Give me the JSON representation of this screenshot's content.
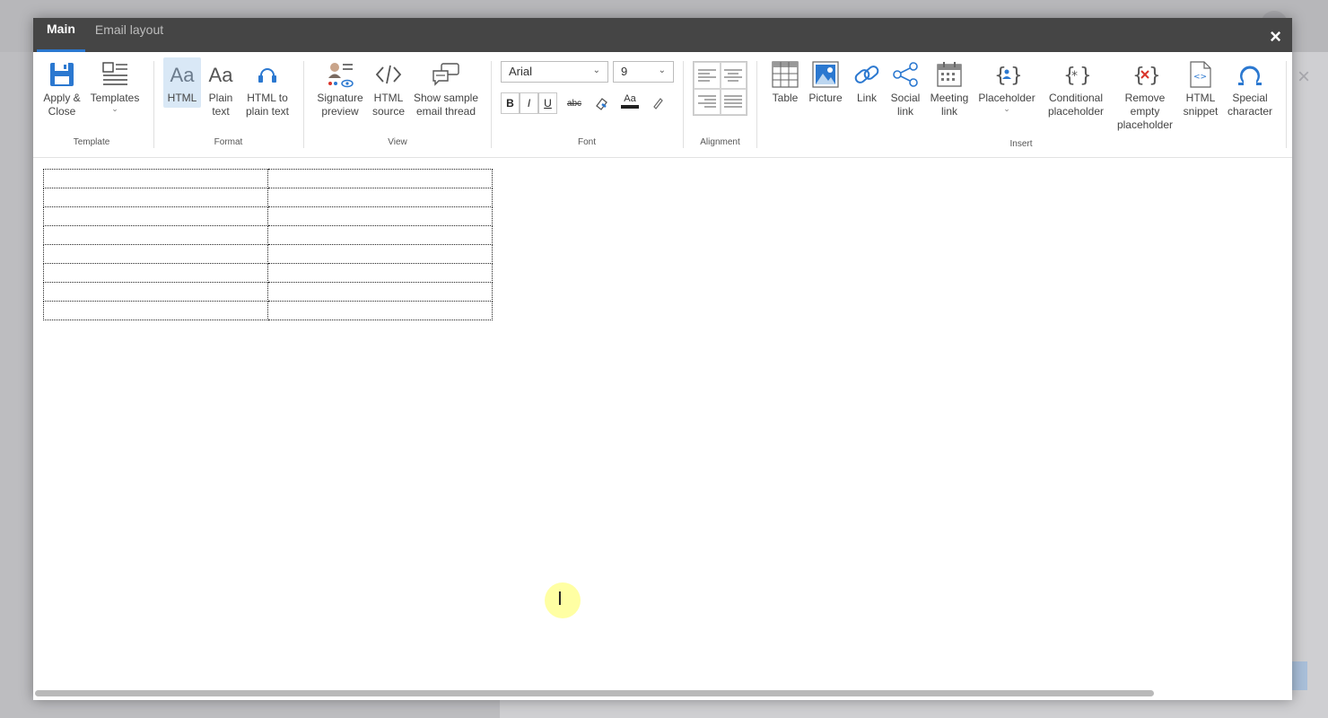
{
  "tabs": [
    {
      "label": "Main",
      "active": true
    },
    {
      "label": "Email layout",
      "active": false
    }
  ],
  "close_label": "×",
  "groups": {
    "template": "Template",
    "format": "Format",
    "view": "View",
    "font": "Font",
    "alignment": "Alignment",
    "insert": "Insert"
  },
  "buttons": {
    "apply_close": [
      "Apply &",
      "Close"
    ],
    "templates": "Templates",
    "html": "HTML",
    "plain_text": [
      "Plain",
      "text"
    ],
    "html_to_plain": [
      "HTML to",
      "plain text"
    ],
    "signature_preview": [
      "Signature",
      "preview"
    ],
    "html_source": [
      "HTML",
      "source"
    ],
    "sample_thread": [
      "Show sample",
      "email thread"
    ],
    "table": "Table",
    "picture": "Picture",
    "link": "Link",
    "social_link": [
      "Social",
      "link"
    ],
    "meeting_link": [
      "Meeting",
      "link"
    ],
    "placeholder": "Placeholder",
    "conditional_placeholder": [
      "Conditional",
      "placeholder"
    ],
    "remove_empty_placeholder": [
      "Remove",
      "empty",
      "placeholder"
    ],
    "html_snippet": [
      "HTML",
      "snippet"
    ],
    "special_character": [
      "Special",
      "character"
    ]
  },
  "font": {
    "family": "Arial",
    "size": "9",
    "bold": "B",
    "italic": "I",
    "underline": "U",
    "strike": "abc",
    "color_label": "Aa"
  },
  "format_glyph": "Aa",
  "colors": {
    "accent": "#2b78d0",
    "tabbar": "#454545",
    "selected": "#d9e8f6",
    "remove_red": "#d9342b"
  },
  "editor": {
    "table_rows": 8,
    "table_cols": 2
  }
}
